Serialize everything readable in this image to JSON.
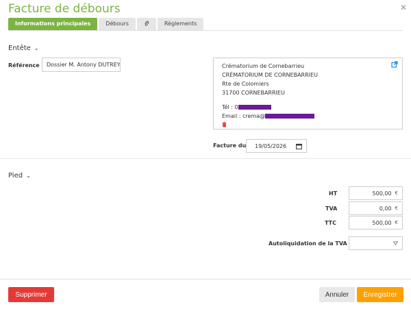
{
  "dialog": {
    "title": "Facture de débours"
  },
  "tabs": [
    {
      "label": "Informations principales"
    },
    {
      "label": "Débours"
    },
    {
      "label": ""
    },
    {
      "label": "Règlements"
    }
  ],
  "entete": {
    "section_label": "Entête",
    "reference_label": "Référence",
    "reference_value": "Dossier M. Antony DUTREY",
    "address": {
      "line1": "Crématorium de Cornebarrieu",
      "line2": "CRÉMATORIUM DE CORNEBARRIEU",
      "line3": "Rte de Colomiers",
      "line4": "31700 CORNEBARRIEU",
      "tel_label": "Tél : 0",
      "email_label": "Email : crema@"
    },
    "facture_du_label": "Facture du",
    "facture_du_value": "19/05/2026"
  },
  "pied": {
    "section_label": "Pied",
    "ht_label": "HT",
    "ht_value": "500,00",
    "tva_label": "TVA",
    "tva_value": "0,00",
    "ttc_label": "TTC",
    "ttc_value": "500,00",
    "currency": "€",
    "autoliq_label": "Autoliquidation de la TVA"
  },
  "footer": {
    "delete_label": "Supprimer",
    "cancel_label": "Annuler",
    "save_label": "Enregistrer"
  },
  "colors": {
    "accent": "#7cb342",
    "danger": "#e53935",
    "save": "#ffa000",
    "redaction": "#6a1b9a",
    "link": "#1e88e5"
  }
}
